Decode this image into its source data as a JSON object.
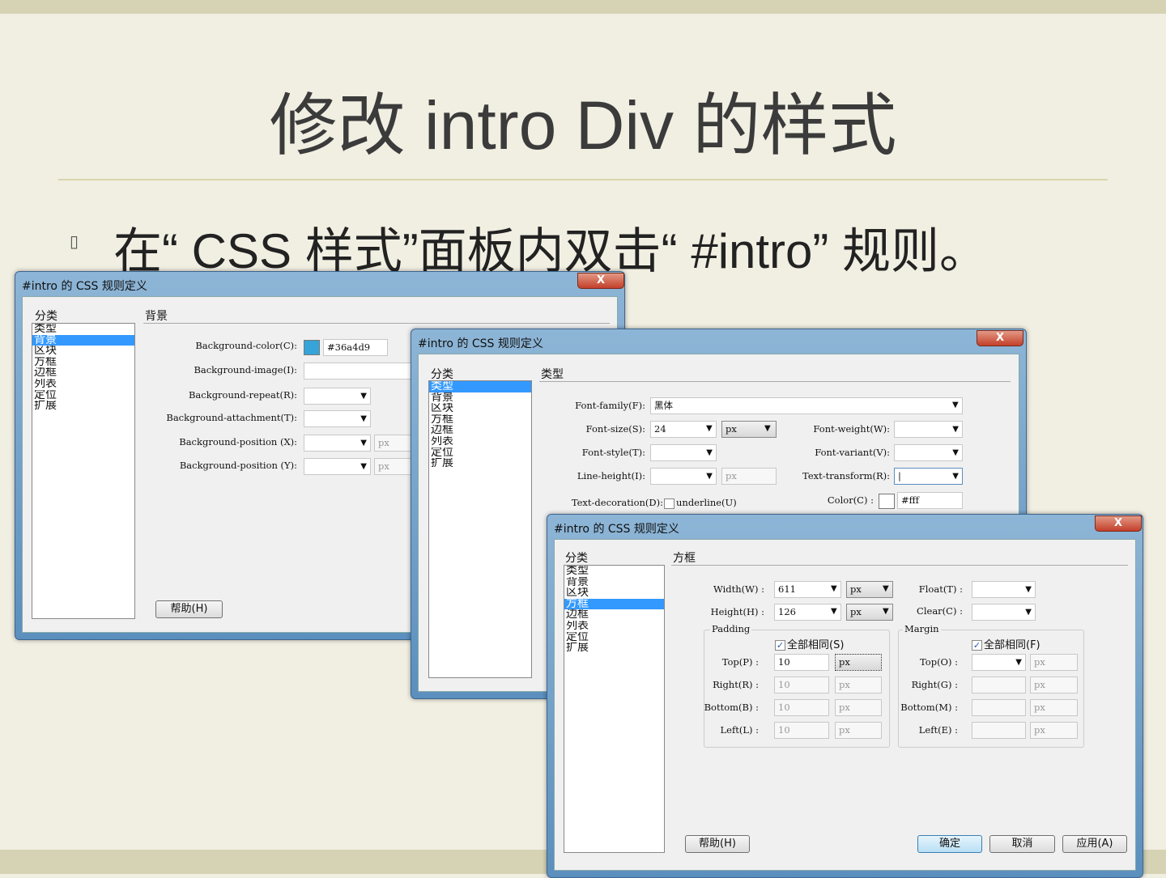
{
  "slide": {
    "title": "修改 intro Div 的样式",
    "bullet_icon": "square-bullet",
    "bullet": "在“ CSS 样式”面板内双击“ #intro” 规则。"
  },
  "dialog_title": "#intro 的 CSS 规则定义",
  "close": "X",
  "category_label": "分类",
  "categories": [
    "类型",
    "背景",
    "区块",
    "方框",
    "边框",
    "列表",
    "定位",
    "扩展"
  ],
  "d1": {
    "section": "背景",
    "bg_color_label": "Background-color(C):",
    "bg_color": "#36a4d9",
    "swatch_color": "#36a4d9",
    "bg_image_label": "Background-image(I):",
    "bg_repeat_label": "Background-repeat(R):",
    "bg_attach_label": "Background-attachment(T):",
    "bg_posx_label": "Background-position (X):",
    "bg_posy_label": "Background-position (Y):",
    "unit": "px",
    "help": "帮助(H)"
  },
  "d2": {
    "section": "类型",
    "font_family_label": "Font-family(F):",
    "font_family": "黑体",
    "font_size_label": "Font-size(S):",
    "font_size": "24",
    "font_size_unit": "px",
    "font_weight_label": "Font-weight(W):",
    "font_style_label": "Font-style(T):",
    "font_variant_label": "Font-variant(V):",
    "line_height_label": "Line-height(I):",
    "line_height_unit": "px",
    "text_transform_label": "Text-transform(R):",
    "text_decoration_label": "Text-decoration(D):",
    "underline": "underline(U)",
    "color_label": "Color(C) :",
    "color": "#fff"
  },
  "d3": {
    "section": "方框",
    "width_label": "Width(W) :",
    "width": "611",
    "height_label": "Height(H) :",
    "height": "126",
    "unit": "px",
    "float_label": "Float(T) :",
    "clear_label": "Clear(C) :",
    "padding": "Padding",
    "margin": "Margin",
    "same_p": "全部相同(S)",
    "same_m": "全部相同(F)",
    "pad_rows": [
      {
        "label": "Top(P) :",
        "value": "10"
      },
      {
        "label": "Right(R) :",
        "value": "10"
      },
      {
        "label": "Bottom(B) :",
        "value": "10"
      },
      {
        "label": "Left(L) :",
        "value": "10"
      }
    ],
    "mar_rows": [
      {
        "label": "Top(O) :"
      },
      {
        "label": "Right(G) :"
      },
      {
        "label": "Bottom(M) :"
      },
      {
        "label": "Left(E) :"
      }
    ],
    "help": "帮助(H)",
    "ok": "确定",
    "cancel": "取消",
    "apply": "应用(A)"
  }
}
